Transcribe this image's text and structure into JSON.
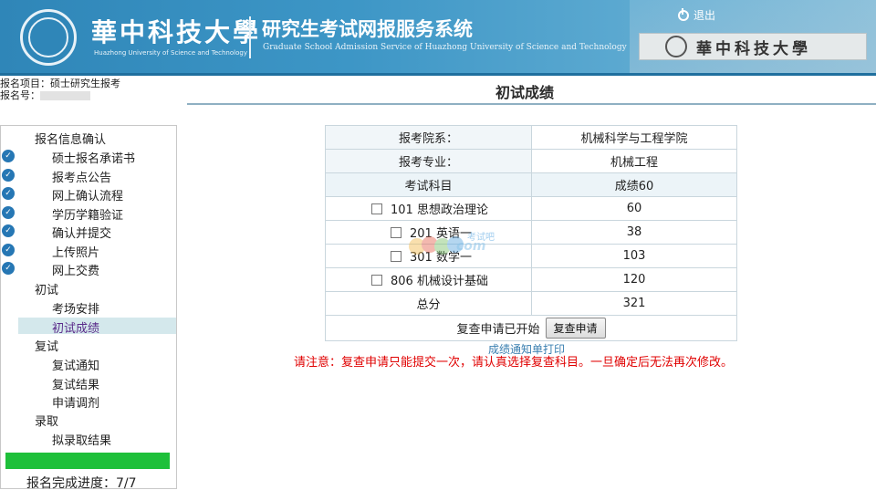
{
  "header": {
    "univ_name": "華中科技大學",
    "univ_en": "Huazhong University of Science and Technology",
    "system_title": "研究生考试网报服务系统",
    "system_en": "Graduate School Admission Service of Huazhong University of Science and Technology",
    "logout_label": "退出",
    "sign_text": "華中科技大學"
  },
  "project": {
    "project_label": "报名项目：",
    "project_value": "硕士研究生报考",
    "number_label": "报名号："
  },
  "page_title": "初试成绩",
  "sidebar": {
    "group1": "报名信息确认",
    "group1_items": [
      {
        "label": "硕士报名承诺书",
        "done": true
      },
      {
        "label": "报考点公告",
        "done": true
      },
      {
        "label": "网上确认流程",
        "done": true
      },
      {
        "label": "学历学籍验证",
        "done": true
      },
      {
        "label": "确认并提交",
        "done": true
      },
      {
        "label": "上传照片",
        "done": true
      },
      {
        "label": "网上交费",
        "done": true
      }
    ],
    "group2": "初试",
    "group2_items": [
      {
        "label": "考场安排"
      },
      {
        "label": "初试成绩",
        "active": true
      }
    ],
    "group3": "复试",
    "group3_items": [
      {
        "label": "复试通知"
      },
      {
        "label": "复试结果"
      },
      {
        "label": "申请调剂"
      }
    ],
    "group4": "录取",
    "group4_items": [
      {
        "label": "拟录取结果"
      }
    ],
    "progress_text": "报名完成进度：7/7",
    "progress_fraction": 1.0,
    "progress_color": "#1ec03a"
  },
  "score": {
    "dept_label": "报考院系：",
    "dept_value": "机械科学与工程学院",
    "major_label": "报考专业：",
    "major_value": "机械工程",
    "subject_header": "考试科目",
    "score_header": "成绩60",
    "subjects": [
      {
        "code": "101",
        "name": "思想政治理论",
        "score": "60"
      },
      {
        "code": "201",
        "name": "英语一",
        "score": "38"
      },
      {
        "code": "301",
        "name": "数学一",
        "score": "103"
      },
      {
        "code": "806",
        "name": "机械设计基础",
        "score": "120"
      }
    ],
    "total_label": "总分",
    "total_value": "321",
    "recheck_status": "复查申请已开始",
    "recheck_button": "复查申请",
    "print_link": "成绩通知单打印",
    "notice": "请注意：复查申请只能提交一次，请认真选择复查科目。一旦确定后无法再次修改。"
  },
  "watermark": {
    "text1": "考试吧",
    "text2": "com"
  }
}
